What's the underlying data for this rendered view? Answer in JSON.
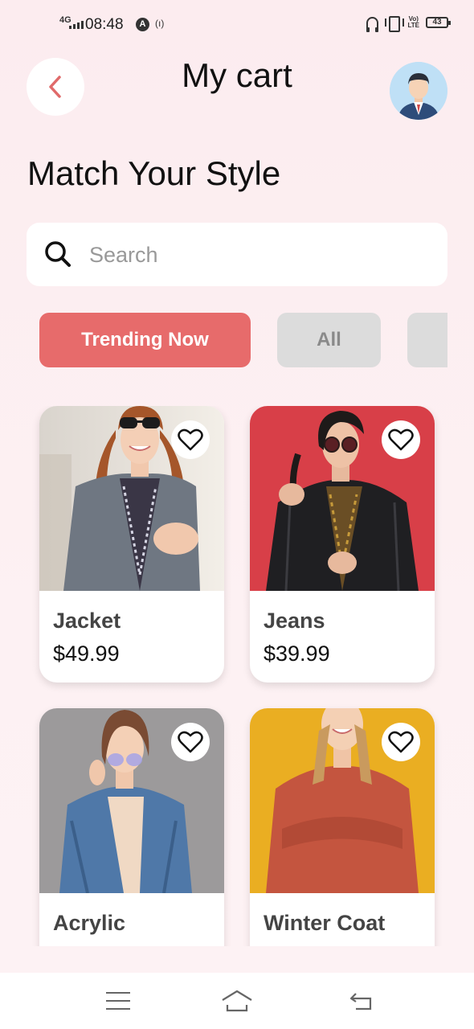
{
  "status_bar": {
    "network": "4G",
    "time": "08:48",
    "app_icon": "A",
    "hotspot": "(ı)",
    "volte": "Vo\nLTE",
    "battery": "43",
    "icons": [
      "signal-icon",
      "hotspot-icon",
      "headphones-icon",
      "vibrate-icon",
      "volte-icon",
      "battery-icon"
    ]
  },
  "header": {
    "title": "My cart",
    "back_icon": "chevron-left-icon",
    "avatar_icon": "user-avatar"
  },
  "section_title": "Match Your Style",
  "search": {
    "placeholder": "Search",
    "icon": "search-icon"
  },
  "tabs": [
    {
      "label": "Trending Now",
      "active": true
    },
    {
      "label": "All",
      "active": false
    },
    {
      "label": "",
      "active": false
    }
  ],
  "products": [
    {
      "name": "Jacket",
      "price": "$49.99",
      "icon": "heart-icon"
    },
    {
      "name": "Jeans",
      "price": "$39.99",
      "icon": "heart-icon"
    },
    {
      "name": "Acrylic",
      "price": "",
      "icon": "heart-icon"
    },
    {
      "name": "Winter Coat",
      "price": "",
      "icon": "heart-icon"
    }
  ],
  "bottom_nav": {
    "icons": [
      "menu-icon",
      "home-icon",
      "back-icon"
    ]
  },
  "colors": {
    "accent": "#e76b6b",
    "background": "#fcecef",
    "tab_inactive": "#dcdcdc"
  }
}
